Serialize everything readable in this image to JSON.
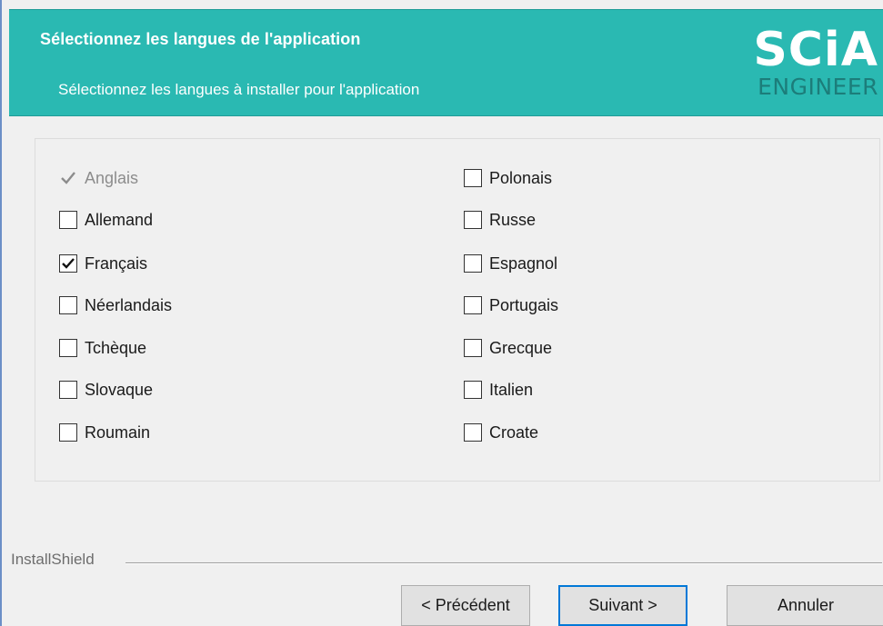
{
  "header": {
    "title": "Sélectionnez les langues de l'application",
    "subtitle": "Sélectionnez les langues à installer pour l'application",
    "logo_main": "SCiA",
    "logo_sub": "ENGINEER"
  },
  "languages": {
    "left": [
      {
        "label": "Anglais",
        "checked": true,
        "disabled": true
      },
      {
        "label": "Allemand",
        "checked": false,
        "disabled": false
      },
      {
        "label": "Français",
        "checked": true,
        "disabled": false
      },
      {
        "label": "Néerlandais",
        "checked": false,
        "disabled": false
      },
      {
        "label": "Tchèque",
        "checked": false,
        "disabled": false
      },
      {
        "label": "Slovaque",
        "checked": false,
        "disabled": false
      },
      {
        "label": "Roumain",
        "checked": false,
        "disabled": false
      }
    ],
    "right": [
      {
        "label": "Polonais",
        "checked": false,
        "disabled": false
      },
      {
        "label": "Russe",
        "checked": false,
        "disabled": false
      },
      {
        "label": "Espagnol",
        "checked": false,
        "disabled": false
      },
      {
        "label": "Portugais",
        "checked": false,
        "disabled": false
      },
      {
        "label": "Grecque",
        "checked": false,
        "disabled": false
      },
      {
        "label": "Italien",
        "checked": false,
        "disabled": false
      },
      {
        "label": "Croate",
        "checked": false,
        "disabled": false
      }
    ]
  },
  "footer": {
    "brand": "InstallShield",
    "back_label": "< Précédent",
    "next_label": "Suivant >",
    "cancel_label": "Annuler"
  },
  "colors": {
    "header_bg": "#2ab9b2",
    "logo_sub": "#1c7d7a",
    "default_button_border": "#0078d7"
  }
}
